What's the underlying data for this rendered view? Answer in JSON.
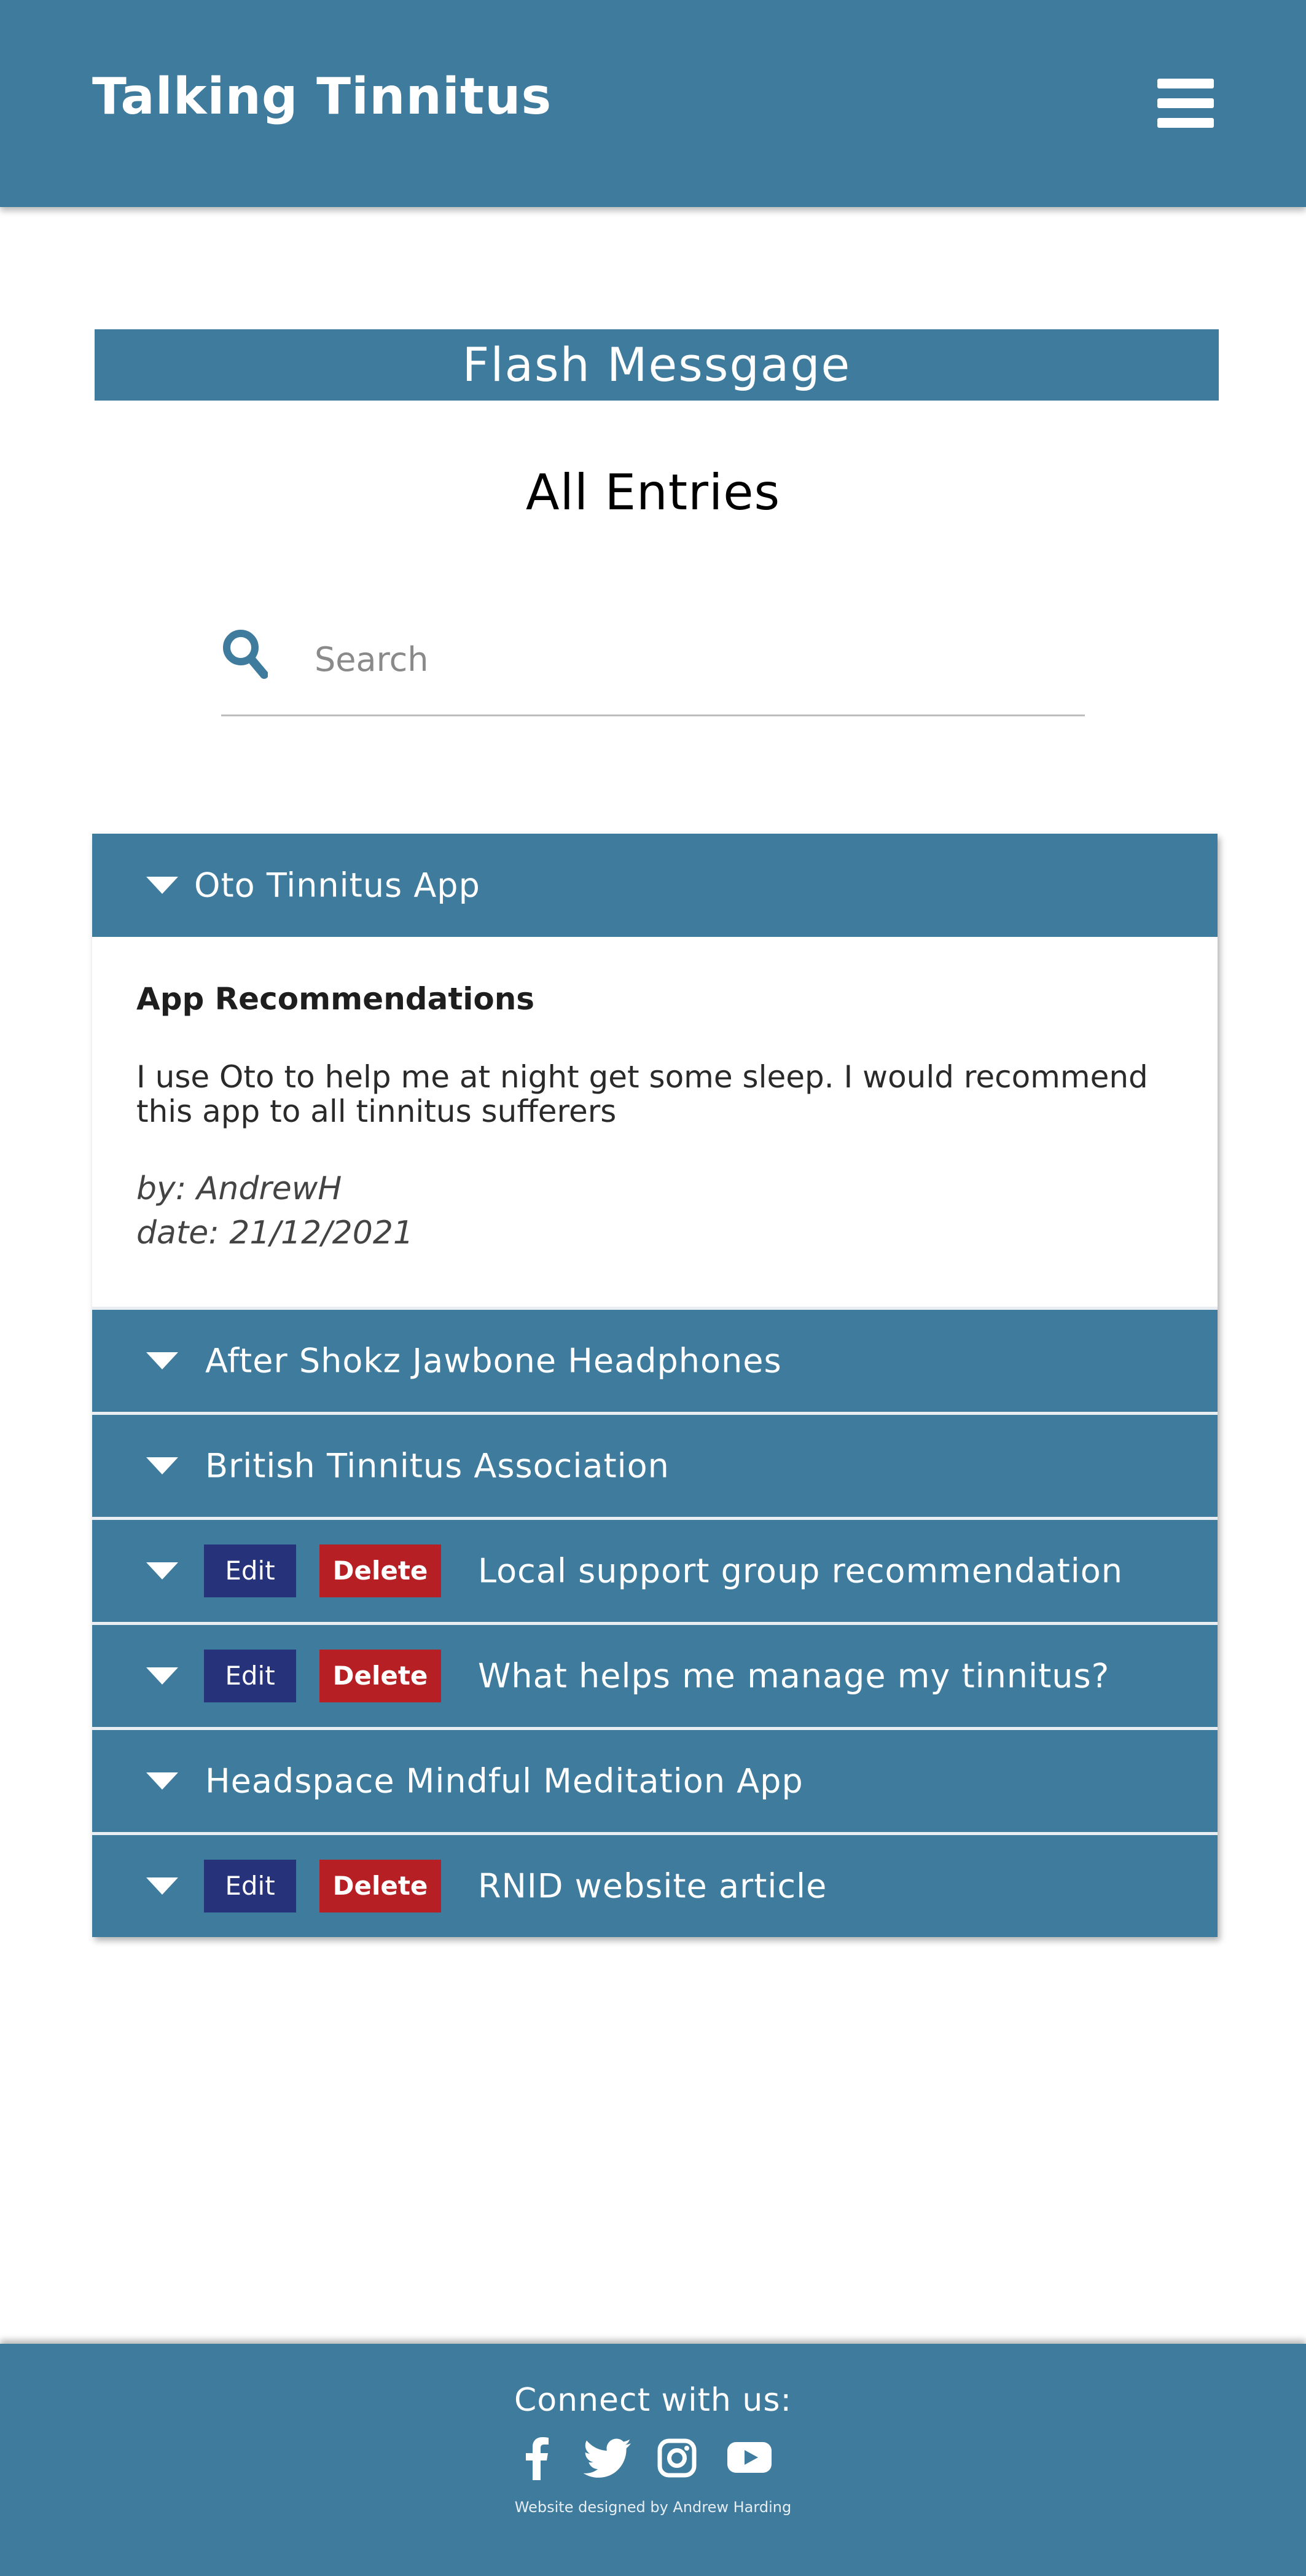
{
  "header": {
    "brand": "Talking Tinnitus",
    "menu_icon": "hamburger-menu-icon"
  },
  "flash": {
    "message": "Flash Messgage"
  },
  "page": {
    "title": "All Entries"
  },
  "search": {
    "placeholder": "Search",
    "value": "",
    "icon": "search-icon"
  },
  "entries": [
    {
      "title": "Oto Tinnitus App",
      "expanded": true,
      "category": "App Recommendations",
      "body": "I use Oto to help me at night get some sleep. I would recommend this app to all tinnitus sufferers",
      "author": "by: AndrewH",
      "date": "date: 21/12/2021"
    },
    {
      "title": "After Shokz Jawbone Headphones"
    },
    {
      "title": "British Tinnitus Association"
    },
    {
      "title": "Local support group recommendation",
      "edit_label": "Edit",
      "delete_label": "Delete"
    },
    {
      "title": "What helps me manage my tinnitus?",
      "edit_label": "Edit",
      "delete_label": "Delete"
    },
    {
      "title": "Headspace Mindful Meditation App"
    },
    {
      "title": "RNID website article",
      "edit_label": "Edit",
      "delete_label": "Delete"
    }
  ],
  "footer": {
    "heading": "Connect with us:",
    "social": [
      "facebook-icon",
      "twitter-icon",
      "instagram-icon",
      "youtube-icon"
    ],
    "credit": "Website designed by Andrew Harding"
  },
  "colors": {
    "primary": "#3f7b9c",
    "edit": "#26337a",
    "delete": "#b61f23"
  }
}
